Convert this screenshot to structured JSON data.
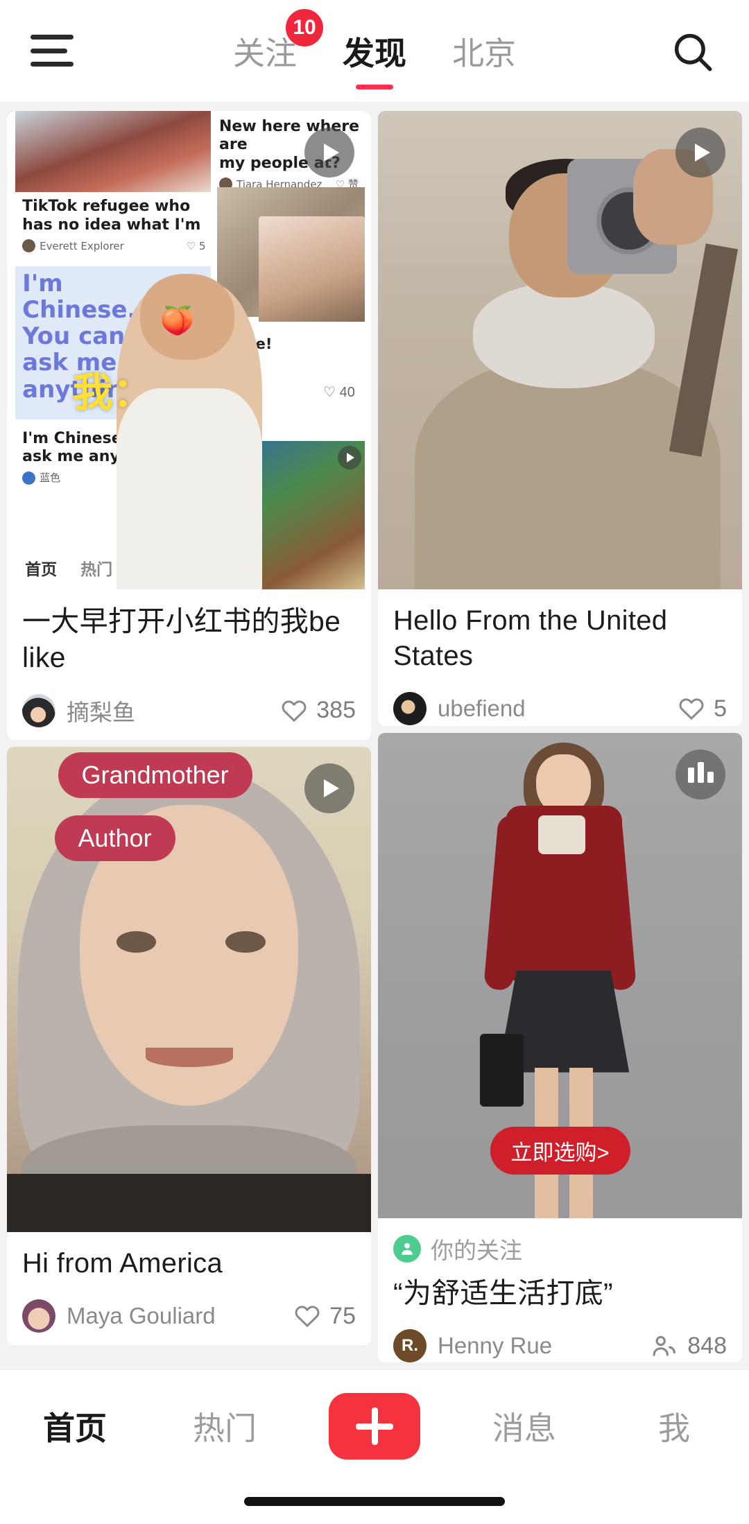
{
  "header": {
    "menu_icon": "hamburger-menu-icon",
    "search_icon": "search-icon",
    "tabs": [
      {
        "label": "关注",
        "badge": "10",
        "active": false
      },
      {
        "label": "发现",
        "badge": "",
        "active": true
      },
      {
        "label": "北京",
        "badge": "",
        "active": false
      }
    ]
  },
  "feed": {
    "cards": [
      {
        "id": "card-xiaohongshu-meme",
        "title": "一大早打开小红书的我be like",
        "author": "摘梨鱼",
        "count": "385",
        "count_icon": "heart-icon",
        "overlay_icon": "play-icon",
        "collage": {
          "cap1_line1": "New here where are",
          "cap1_line2": "my people at?",
          "cap1_user": "Tiara Hernandez",
          "cap1_action": "赞",
          "cap2_line1": "TikTok refugee who",
          "cap2_line2": "has no idea what I'm",
          "cap2_user": "Everett Explorer",
          "cap2_count": "5",
          "blue_l1": "I'm",
          "blue_l2": "Chinese.",
          "blue_l3": "You can",
          "blue_l4": "ask me",
          "blue_l5": "anything",
          "emoji": "🍑",
          "wo_label": "我：",
          "cap3_line1": "I'm Chinese. You",
          "cap3_line2": "ask me anything",
          "cap3_user": "蓝色",
          "mid_count": "40",
          "mid_greeting": "H...e!",
          "footer_tab1": "首页",
          "footer_tab2": "热门"
        }
      },
      {
        "id": "card-hello-us",
        "title": "Hello From the United States",
        "author": "ubefiend",
        "count": "5",
        "count_icon": "heart-icon",
        "overlay_icon": "play-icon"
      },
      {
        "id": "card-hi-america",
        "title": "Hi from America",
        "author": "Maya Gouliard",
        "count": "75",
        "count_icon": "heart-icon",
        "overlay_icon": "play-icon",
        "bubbles": {
          "top": "Grandmother",
          "bottom": "Author"
        }
      },
      {
        "id": "card-comfort-life",
        "follow_tag": "你的关注",
        "follow_tag_icon": "person-icon",
        "title": "“为舒适生活打底”",
        "author": "Henny Rue",
        "avatar_initial": "R.",
        "count": "848",
        "count_icon": "people-icon",
        "overlay_icon": "bar-chart-icon",
        "shop_button": "立即选购>"
      }
    ]
  },
  "bottom_nav": {
    "items": [
      {
        "label": "首页",
        "active": true
      },
      {
        "label": "热门",
        "active": false
      },
      {
        "label": "",
        "active": false,
        "icon": "plus-icon"
      },
      {
        "label": "消息",
        "active": false
      },
      {
        "label": "我",
        "active": false
      }
    ]
  },
  "colors": {
    "accent_red": "#f5333f",
    "badge_red": "#f0273c",
    "tab_underline": "#ff2e4d",
    "follow_green": "#4ecb8e",
    "shop_red": "#cf1f2a",
    "bubble_red": "#bf3a52"
  }
}
